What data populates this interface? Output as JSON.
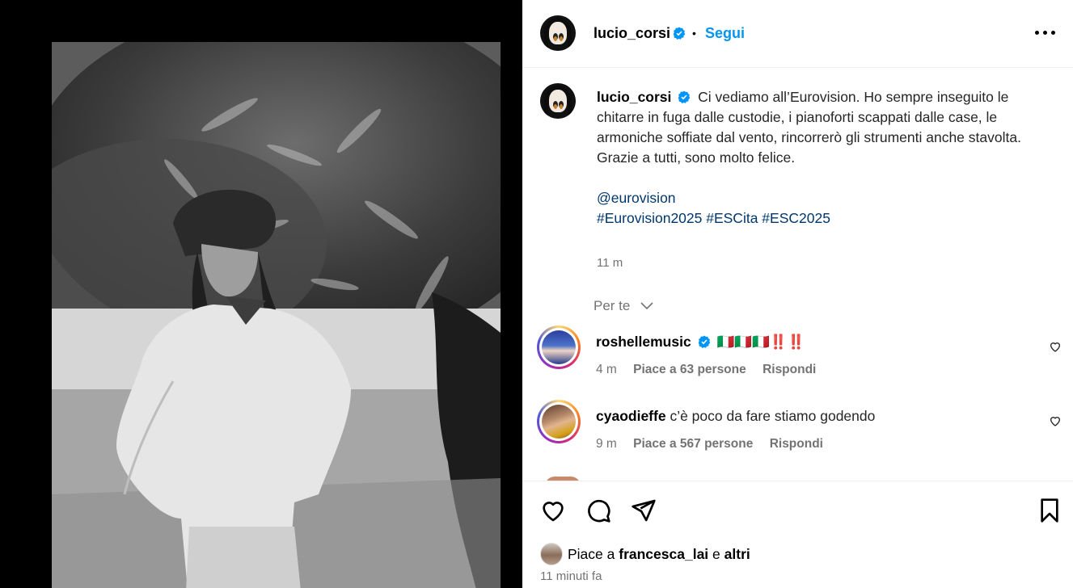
{
  "post": {
    "username": "lucio_corsi",
    "follow_label": "Segui",
    "separator": "•",
    "more_icon": "more-options-icon"
  },
  "caption": {
    "username": "lucio_corsi",
    "line1": "Ci vediamo all’Eurovision. Ho sempre inseguito le chitarre in fuga dalle custodie, i pianoforti scappati dalle case, le armoniche soffiate dal vento, rincorrerò gli strumenti anche stavolta.",
    "line2": "Grazie a tutti, sono molto felice.",
    "mention": "@eurovision",
    "hashtags": "#Eurovision2025 #ESCita #ESC2025",
    "time": "11 m"
  },
  "filter": {
    "label": "Per te"
  },
  "comments": [
    {
      "user": "roshellemusic",
      "verified": true,
      "text": "🇮🇹🇮🇹🇮🇹‼️‼️",
      "time": "4 m",
      "likes": "Piace a 63 persone",
      "reply": "Rispondi"
    },
    {
      "user": "cyaodieffe",
      "verified": false,
      "text": "c’è poco da fare stiamo godendo",
      "time": "9 m",
      "likes": "Piace a 567 persone",
      "reply": "Rispondi"
    }
  ],
  "footer": {
    "likes_prefix": "Piace a",
    "likes_user": "francesca_lai",
    "likes_and": "e",
    "likes_others": "altri",
    "posted": "11 minuti fa"
  },
  "colors": {
    "accent": "#0095f6",
    "link": "#00376b",
    "muted": "#737373",
    "verified": "#0095f6"
  }
}
